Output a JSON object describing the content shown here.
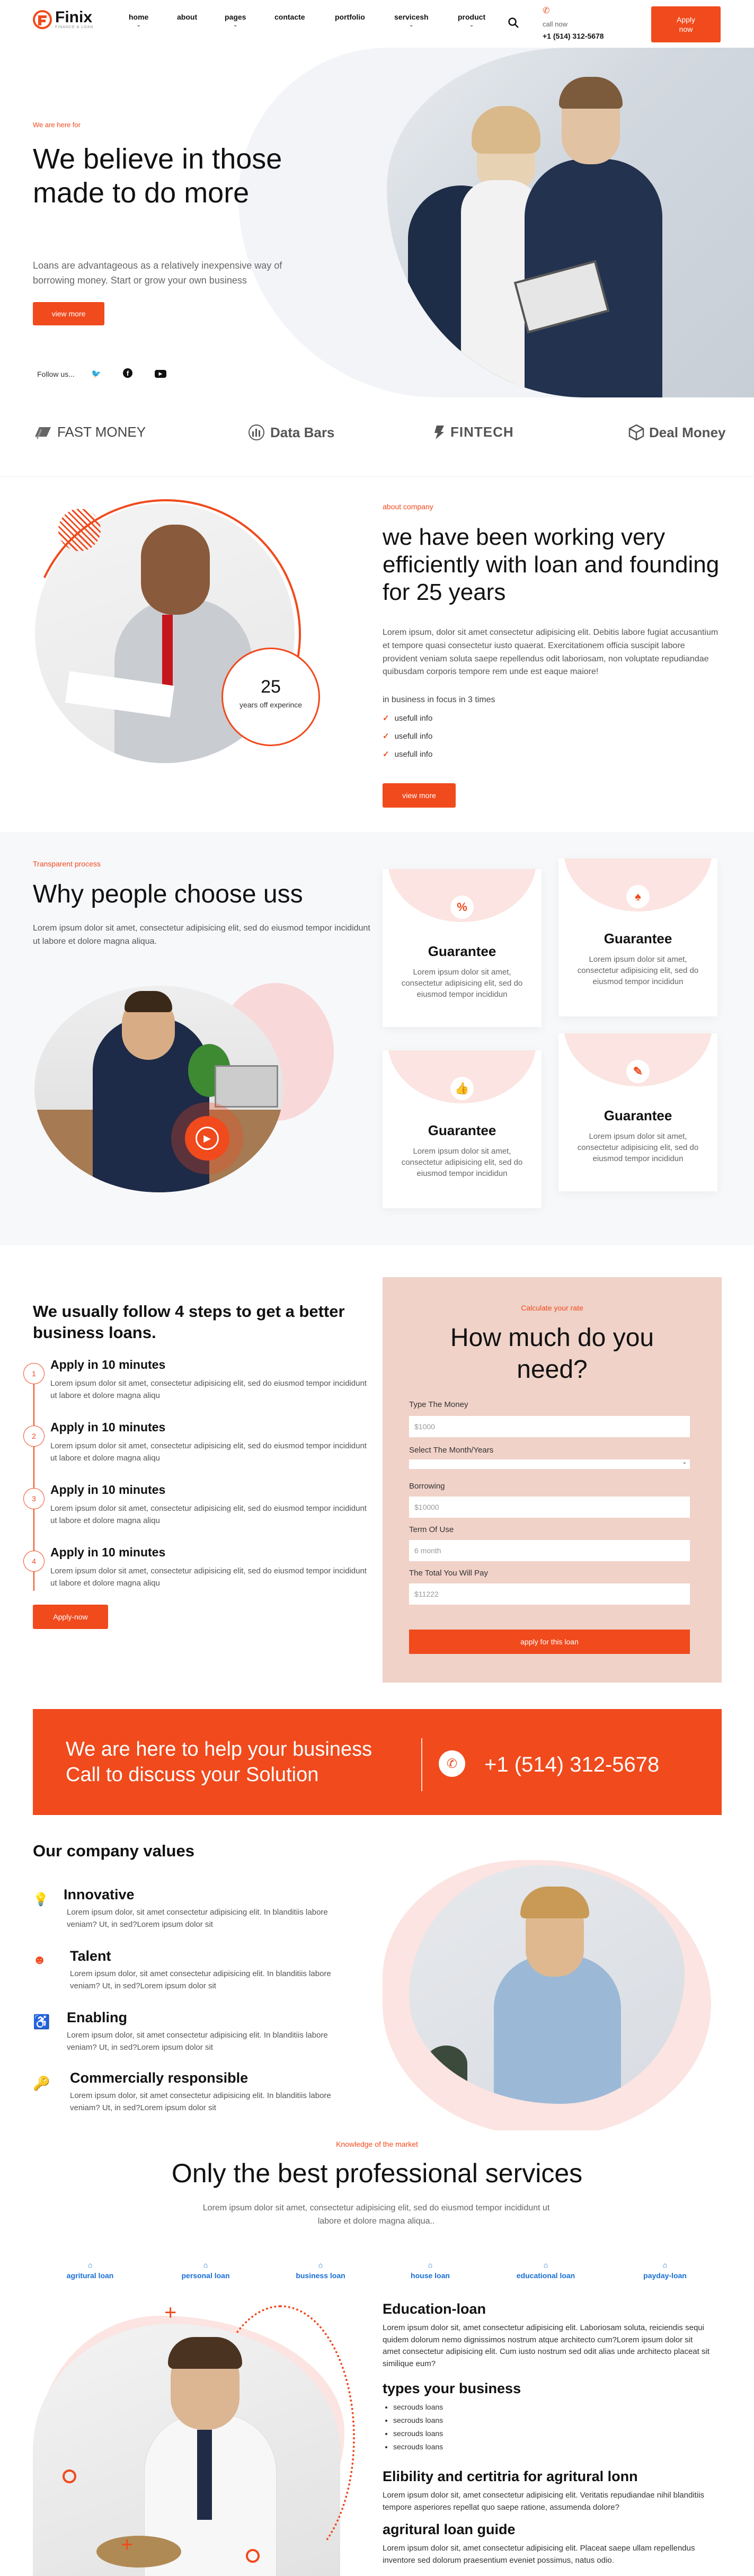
{
  "header": {
    "logo": "Finix",
    "logo_tag": "FINANCE & LOAN",
    "nav": [
      "home",
      "about",
      "pages",
      "contacte",
      "portfolio",
      "servicesh",
      "product"
    ],
    "call_label": "call now",
    "phone": "+1 (514) 312-5678",
    "apply": "Apply now"
  },
  "hero": {
    "eyebrow": "We are here for",
    "title": "We believe in those made to do more",
    "text": "Loans are advantageous as a relatively inexpensive way of borrowing money. Start or grow your own business",
    "button": "view more",
    "follow": "Follow us..."
  },
  "brands": [
    "FAST MONEY",
    "Data Bars",
    "FINTECH",
    "Deal Money"
  ],
  "about": {
    "badge_num": "25",
    "badge_text": "years off experince",
    "eyebrow": "about company",
    "title": "we have been working very efficiently with loan and founding for 25 years",
    "text": "Lorem ipsum, dolor sit amet consectetur adipisicing elit. Debitis labore fugiat accusantium et tempore quasi consectetur iusto quaerat. Exercitationem officia suscipit labore provident veniam soluta saepe repellendus odit laboriosam, non voluptate repudiandae quibusdam corporis tempore rem unde est eaque maiore!",
    "sub": "in business in focus in 3 times",
    "checks": [
      "usefull info",
      "usefull info",
      "usefull info"
    ],
    "button": "view more"
  },
  "why": {
    "eyebrow": "Transparent process",
    "title": "Why people choose uss",
    "text": "Lorem ipsum dolor sit amet, consectetur adipisicing elit, sed do eiusmod tempor incididunt ut labore et dolore magna aliqua.",
    "cards": [
      {
        "icon": "%",
        "title": "Guarantee",
        "text": "Lorem ipsum dolor sit amet, consectetur adipisicing elit, sed do eiusmod tempor incididun"
      },
      {
        "icon": "♠",
        "title": "Guarantee",
        "text": "Lorem ipsum dolor sit amet, consectetur adipisicing elit, sed do eiusmod tempor incididun"
      },
      {
        "icon": "👍",
        "title": "Guarantee",
        "text": "Lorem ipsum dolor sit amet, consectetur adipisicing elit, sed do eiusmod tempor incididun"
      },
      {
        "icon": "✎",
        "title": "Guarantee",
        "text": "Lorem ipsum dolor sit amet, consectetur adipisicing elit, sed do eiusmod tempor incididun"
      }
    ]
  },
  "steps": {
    "title": "We usually follow 4 steps to get a better business loans.",
    "items": [
      {
        "n": "1",
        "title": "Apply in 10 minutes",
        "text": "Lorem ipsum dolor sit amet, consectetur adipisicing elit, sed do eiusmod tempor incididunt ut labore et dolore magna aliqu"
      },
      {
        "n": "2",
        "title": "Apply in 10 minutes",
        "text": "Lorem ipsum dolor sit amet, consectetur adipisicing elit, sed do eiusmod tempor incididunt ut labore et dolore magna aliqu"
      },
      {
        "n": "3",
        "title": "Apply in 10 minutes",
        "text": "Lorem ipsum dolor sit amet, consectetur adipisicing elit, sed do eiusmod tempor incididunt ut labore et dolore magna aliqu"
      },
      {
        "n": "4",
        "title": "Apply in 10 minutes",
        "text": "Lorem ipsum dolor sit amet, consectetur adipisicing elit, sed do eiusmod tempor incididunt ut labore et dolore magna aliqu"
      }
    ],
    "button": "Apply-now"
  },
  "calc": {
    "eyebrow": "Calculate your rate",
    "title": "How much do you need?",
    "f1_label": "Type The Money",
    "f1_ph": "$1000",
    "f2_label": "Select The Month/Years",
    "f3_label": "Borrowing",
    "f3_ph": "$10000",
    "f4_label": "Term Of Use",
    "f4_ph": "6 month",
    "f5_label": "The Total You Will Pay",
    "f5_ph": "$11222",
    "button": "apply for this loan"
  },
  "cta": {
    "line1": "We are here to help your business",
    "line2": "Call to discuss your Solution",
    "phone": "+1 (514) 312-5678"
  },
  "values": {
    "title": "Our company values",
    "items": [
      {
        "title": "Innovative",
        "text": "Lorem ipsum dolor, sit amet consectetur adipisicing elit. In blanditiis labore veniam? Ut, in sed?Lorem ipsum dolor sit"
      },
      {
        "title": "Talent",
        "text": "Lorem ipsum dolor, sit amet consectetur adipisicing elit. In blanditiis labore veniam? Ut, in sed?Lorem ipsum dolor sit"
      },
      {
        "title": "Enabling",
        "text": "Lorem ipsum dolor, sit amet consectetur adipisicing elit. In blanditiis labore veniam? Ut, in sed?Lorem ipsum dolor sit"
      },
      {
        "title": "Commercially responsible",
        "text": "Lorem ipsum dolor, sit amet consectetur adipisicing elit. In blanditiis labore veniam? Ut, in sed?Lorem ipsum dolor sit"
      }
    ]
  },
  "services": {
    "eyebrow": "Knowledge of the market",
    "title": "Only the best professional services",
    "text": "Lorem ipsum dolor sit amet, consectetur adipisicing elit, sed do eiusmod tempor incididunt ut labore et dolore magna aliqua..",
    "tabs": [
      "agritural loan",
      "personal loan",
      "business loan",
      "house loan",
      "educational loan",
      "payday-loan"
    ],
    "h1": "Education-loan",
    "p1": "Lorem ipsum dolor sit, amet consectetur adipisicing elit. Laboriosam soluta, reiciendis sequi quidem dolorum nemo dignissimos nostrum atque architecto cum?Lorem ipsum dolor sit amet consectetur adipisicing elit. Cum iusto nostrum sed odit alias unde architecto placeat sit similique eum?",
    "h2": "types your business",
    "list": [
      "secrouds loans",
      "secrouds loans",
      "secrouds loans",
      "secrouds loans"
    ],
    "h3": "Elibility and certitria for agritural lonn",
    "p3": "Lorem ipsum dolor sit, amet consectetur adipisicing elit. Veritatis repudiandae nihil blanditiis tempore asperiores repellat quo saepe ratione, assumenda dolore?",
    "h4": "agritural loan guide",
    "p4": "Lorem ipsum dolor sit, amet consectetur adipisicing elit. Placeat saepe ullam repellendus inventore sed dolorum praesentium eveniet possimus, natus odio."
  },
  "colors": {
    "accent": "#f04a1d",
    "blush": "#fbe4e1",
    "panel": "#f0d2c8",
    "link": "#1a6fd4"
  }
}
